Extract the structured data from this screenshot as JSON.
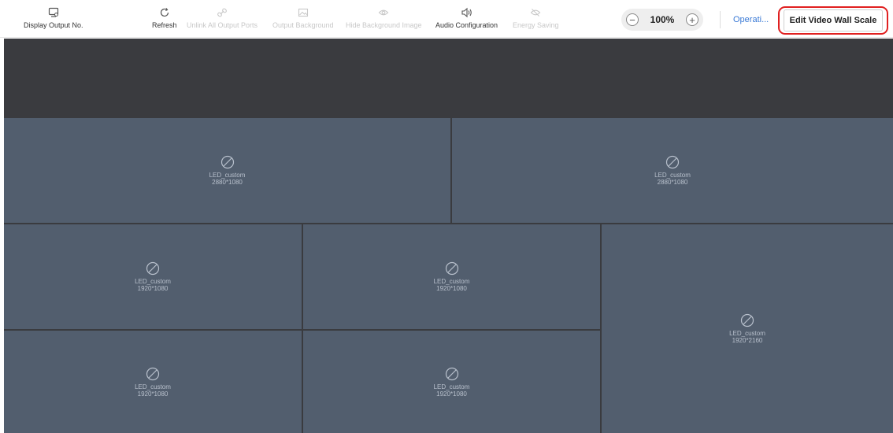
{
  "toolbar": {
    "display_output": "Display Output No.",
    "refresh": "Refresh",
    "unlink": "Unlink All Output Ports",
    "output_bg": "Output Background",
    "hide_bg": "Hide Background Image",
    "audio": "Audio Configuration",
    "energy": "Energy Saving",
    "zoom": "100%",
    "zoom_minus": "−",
    "zoom_plus": "+",
    "operations": "Operati...",
    "edit_scale": "Edit Video Wall Scale"
  },
  "screens": [
    {
      "name": "LED_custom",
      "resolution": "2880*1080"
    },
    {
      "name": "LED_custom",
      "resolution": "2880*1080"
    },
    {
      "name": "LED_custom",
      "resolution": "1920*1080"
    },
    {
      "name": "LED_custom",
      "resolution": "1920*1080"
    },
    {
      "name": "LED_custom",
      "resolution": "1920*2160"
    },
    {
      "name": "LED_custom",
      "resolution": "1920*1080"
    },
    {
      "name": "LED_custom",
      "resolution": "1920*1080"
    }
  ],
  "colors": {
    "accent": "#3c7bd6",
    "highlight": "#e02020",
    "screen": "#525e6e",
    "background": "#3a3b3f"
  }
}
